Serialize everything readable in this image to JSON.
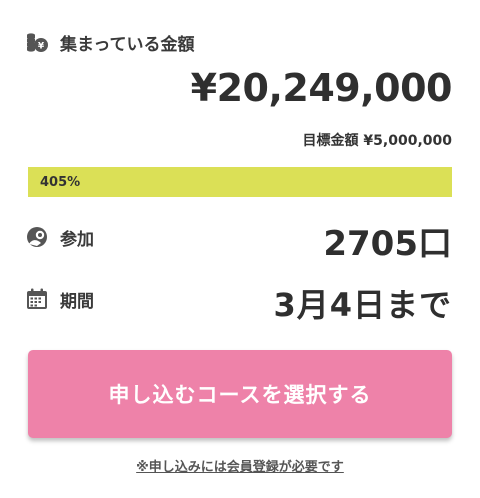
{
  "raised": {
    "label": "集まっている金額",
    "amount": "¥20,249,000"
  },
  "goal": {
    "text": "目標金額 ¥5,000,000"
  },
  "progress": {
    "label": "405%",
    "percent": 405,
    "bar_color": "#dbe056"
  },
  "supporters": {
    "label": "参加",
    "value": "2705口"
  },
  "period": {
    "label": "期間",
    "value": "3月4日まで"
  },
  "cta": {
    "label": "申し込むコースを選択する",
    "color": "#ee82a9"
  },
  "note": {
    "text": "※申し込みには会員登録が必要です"
  },
  "icons": {
    "raised": "coins-icon",
    "supporters": "supporter-icon",
    "period": "calendar-icon"
  }
}
